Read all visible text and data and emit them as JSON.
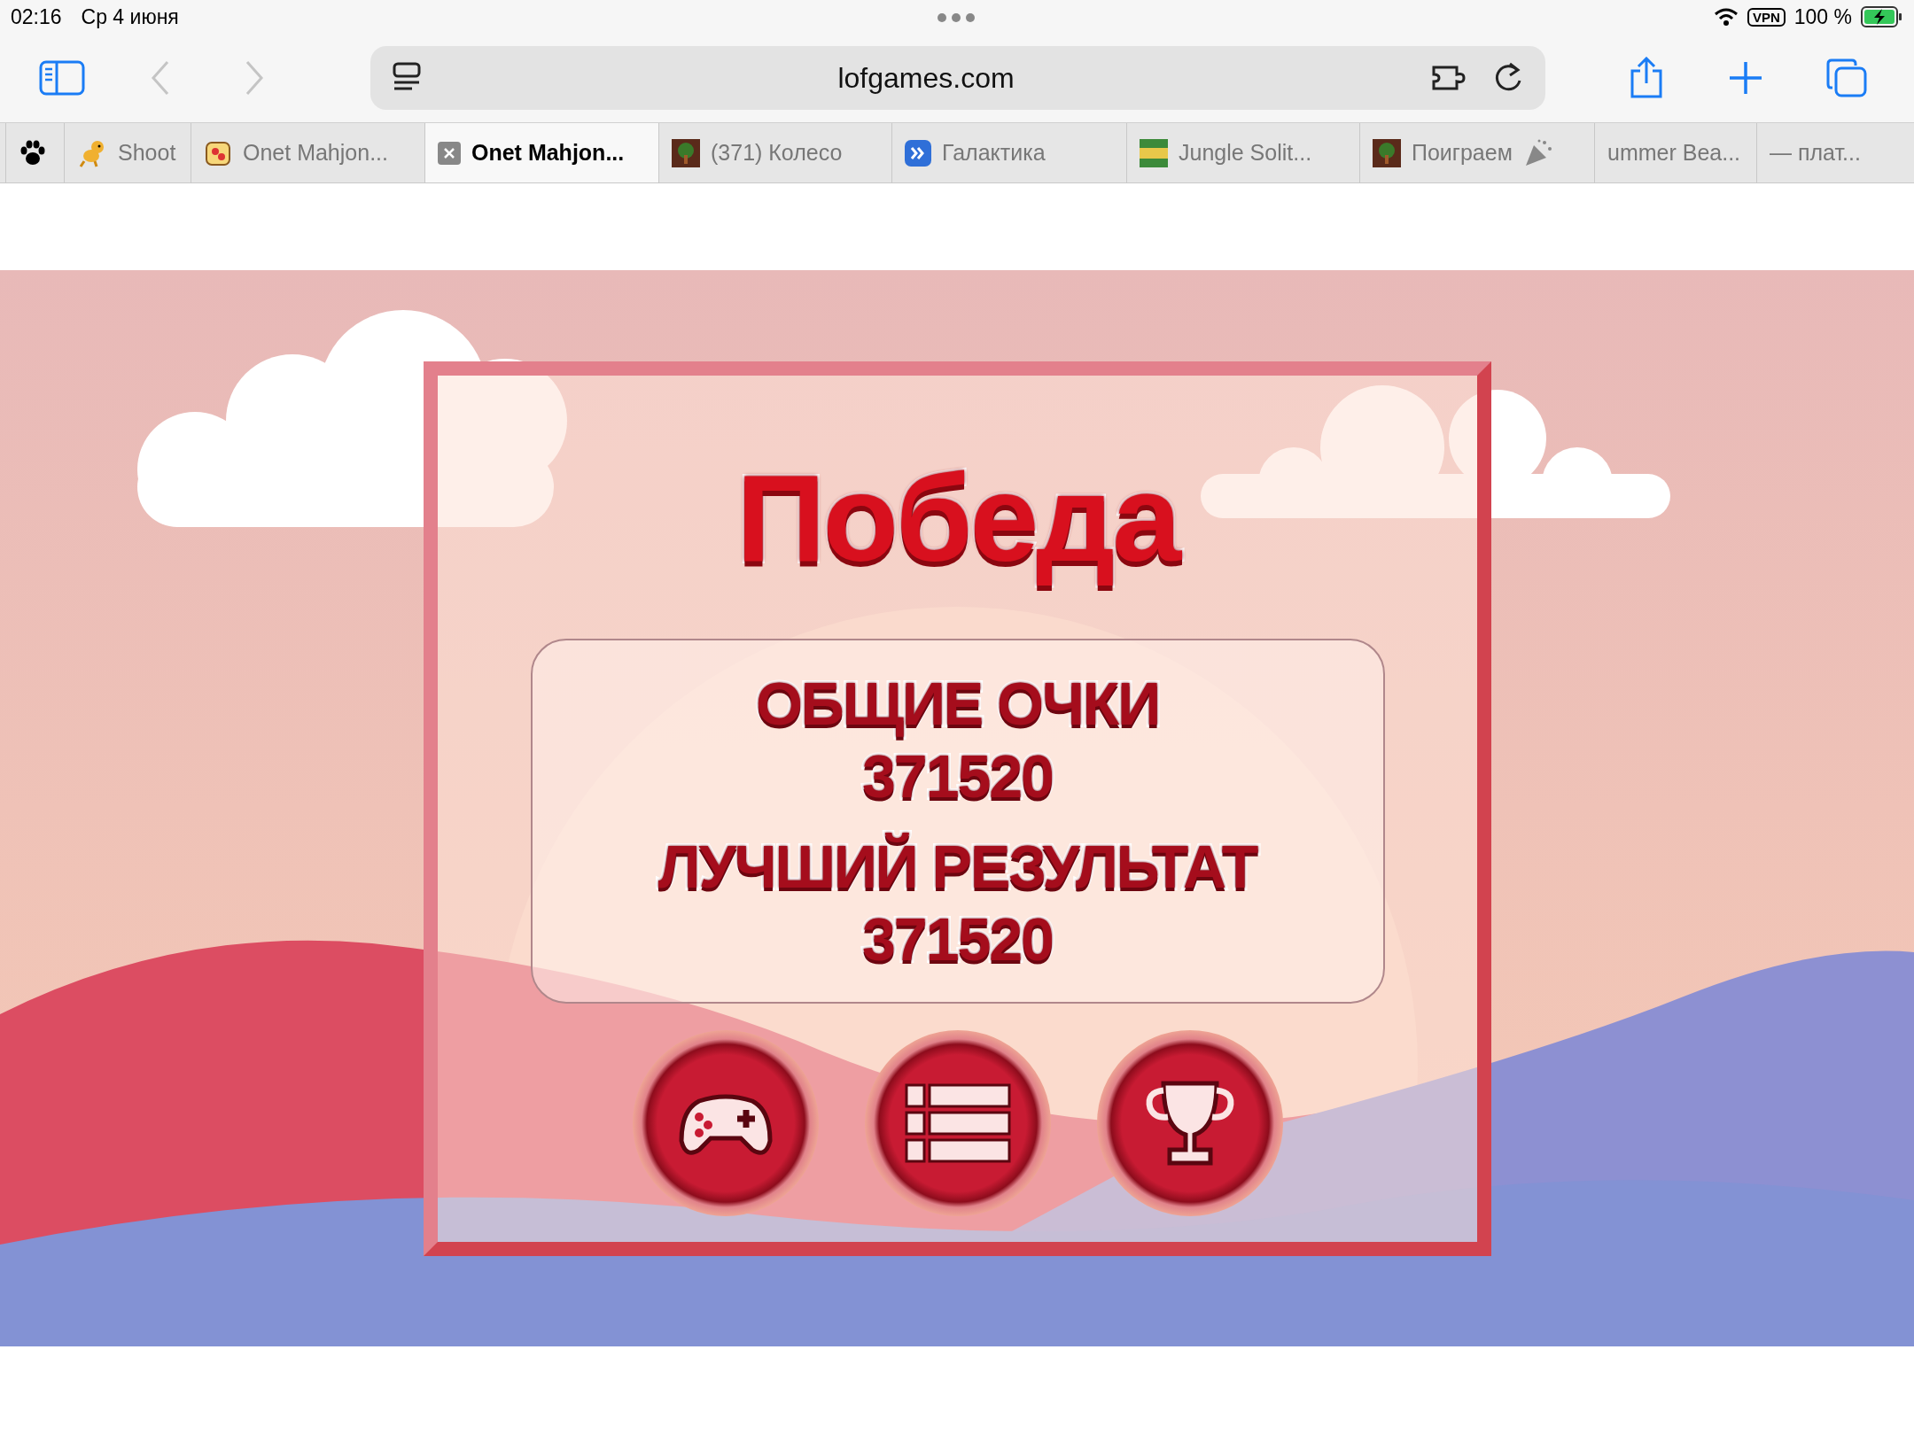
{
  "status_bar": {
    "time": "02:16",
    "date": "Ср 4 июня",
    "vpn": "VPN",
    "battery": "100 %"
  },
  "address_bar": {
    "url": "lofgames.com"
  },
  "tabs": [
    {
      "selected": false
    },
    {
      "label": "Shoot",
      "selected": false
    },
    {
      "label": "Onet Mahjon...",
      "selected": false
    },
    {
      "label": "Onet Mahjon...",
      "selected": true
    },
    {
      "label": "(371) Колесо",
      "selected": false
    },
    {
      "label": "Галактика",
      "selected": false
    },
    {
      "label": "Jungle Solit...",
      "selected": false
    },
    {
      "label": "Поиграем",
      "selected": false
    },
    {
      "label": "ummer Bea...",
      "selected": false
    },
    {
      "label": "— плат...",
      "selected": false
    }
  ],
  "game": {
    "title": "Победа",
    "score_label": "ОБЩИЕ ОЧКИ",
    "score": "371520",
    "best_label": "ЛУЧШИЙ РЕЗУЛЬТАТ",
    "best": "371520"
  }
}
